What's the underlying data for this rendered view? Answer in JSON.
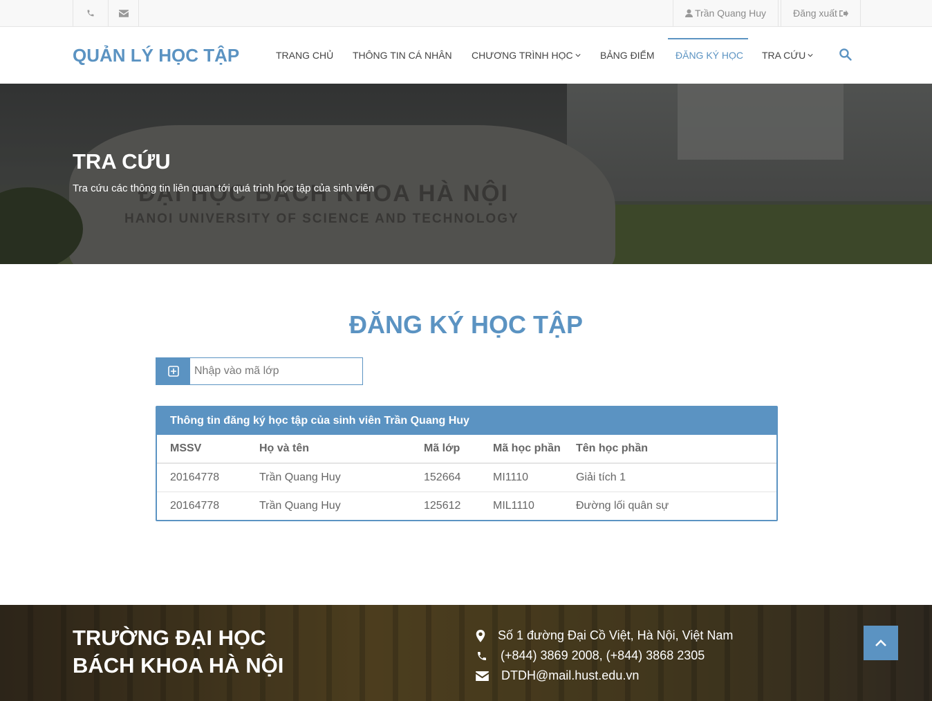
{
  "topbar": {
    "user_name": "Trần Quang Huy",
    "logout_label": "Đăng xuất"
  },
  "nav": {
    "logo": "QUẢN LÝ HỌC TẬP",
    "items": [
      {
        "label": "TRANG CHỦ"
      },
      {
        "label": "THÔNG TIN CÁ NHÂN"
      },
      {
        "label": "CHƯƠNG TRÌNH HỌC"
      },
      {
        "label": "BẢNG ĐIỂM"
      },
      {
        "label": "ĐĂNG KÝ HỌC"
      },
      {
        "label": "TRA CỨU"
      }
    ],
    "active_color": "#5b93c2"
  },
  "hero": {
    "title": "TRA CỨU",
    "subtitle": "Tra cứu các thông tin liên quan tới quá trình học tập của sinh viên",
    "stone_line1": "ĐẠI HỌC BÁCH KHOA HÀ NỘI",
    "stone_line2": "HANOI UNIVERSITY OF SCIENCE AND TECHNOLOGY"
  },
  "main": {
    "title": "ĐĂNG KÝ HỌC TẬP",
    "class_input_placeholder": "Nhập vào mã lớp",
    "panel_title": "Thông tin đăng ký học tập của sinh viên Trần Quang Huy",
    "columns": [
      "MSSV",
      "Họ và tên",
      "Mã lớp",
      "Mã học phần",
      "Tên học phần"
    ],
    "rows": [
      [
        "20164778",
        "Trần Quang Huy",
        "152664",
        "MI1110",
        "Giải tích 1"
      ],
      [
        "20164778",
        "Trần Quang Huy",
        "125612",
        "MIL1110",
        "Đường lối quân sự"
      ]
    ]
  },
  "footer": {
    "title_line1": "TRƯỜNG ĐẠI HỌC",
    "title_line2": "BÁCH KHOA HÀ NỘI",
    "address": "Số 1 đường Đại Cồ Việt, Hà Nội, Việt Nam",
    "phone": "(+844) 3869 2008, (+844) 3868 2305",
    "email": "DTDH@mail.hust.edu.vn"
  }
}
